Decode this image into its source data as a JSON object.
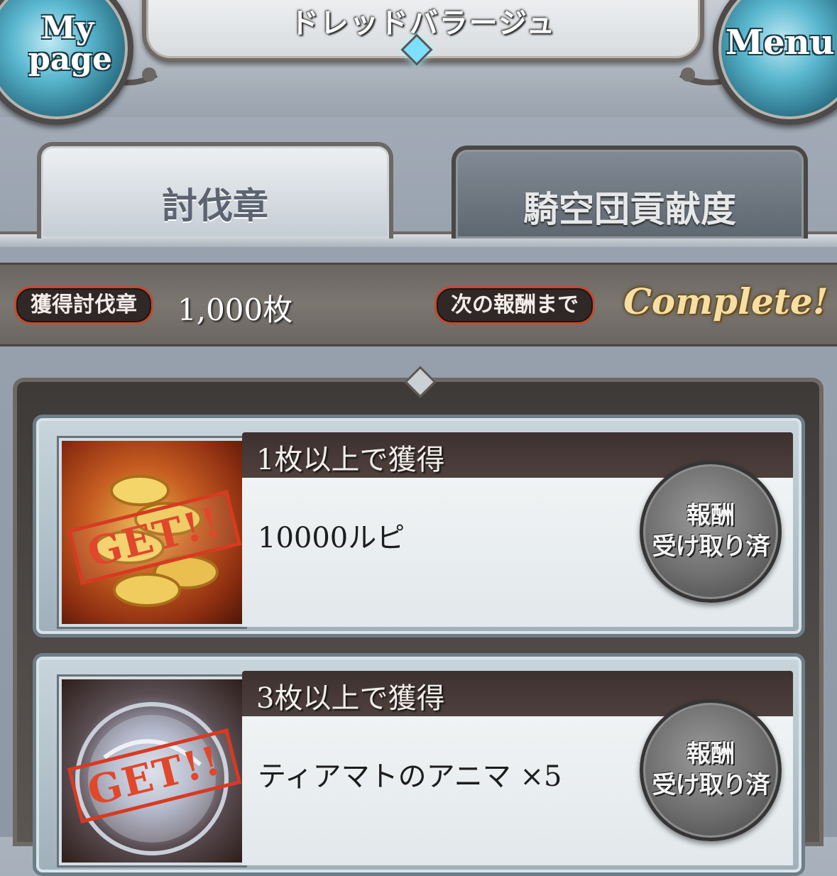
{
  "header": {
    "title": "ドレッドバラージュ",
    "mypage_label": "My page",
    "menu_label": "Menu"
  },
  "tabs": [
    {
      "label": "討伐章",
      "active": true
    },
    {
      "label": "騎空団貢献度",
      "active": false
    }
  ],
  "status": {
    "earned_label": "獲得討伐章",
    "earned_value": "1,000枚",
    "next_label": "次の報酬まで",
    "next_value": "Complete!"
  },
  "rewards": [
    {
      "requirement": "1枚以上で獲得",
      "item": "10000ルピ",
      "stamp": "GET!!",
      "icon": "rupie-coins-icon",
      "claim_line1": "報酬",
      "claim_line2": "受け取り済"
    },
    {
      "requirement": "3枚以上で獲得",
      "item": "ティアマトのアニマ ×5",
      "stamp": "GET!!",
      "icon": "tiamat-anima-orb-icon",
      "claim_line1": "報酬",
      "claim_line2": "受け取り済"
    }
  ],
  "colors": {
    "accent_red": "#c24a2c",
    "complete_gold": "#f5dfa4",
    "orb_blue": "#59b7cf"
  }
}
